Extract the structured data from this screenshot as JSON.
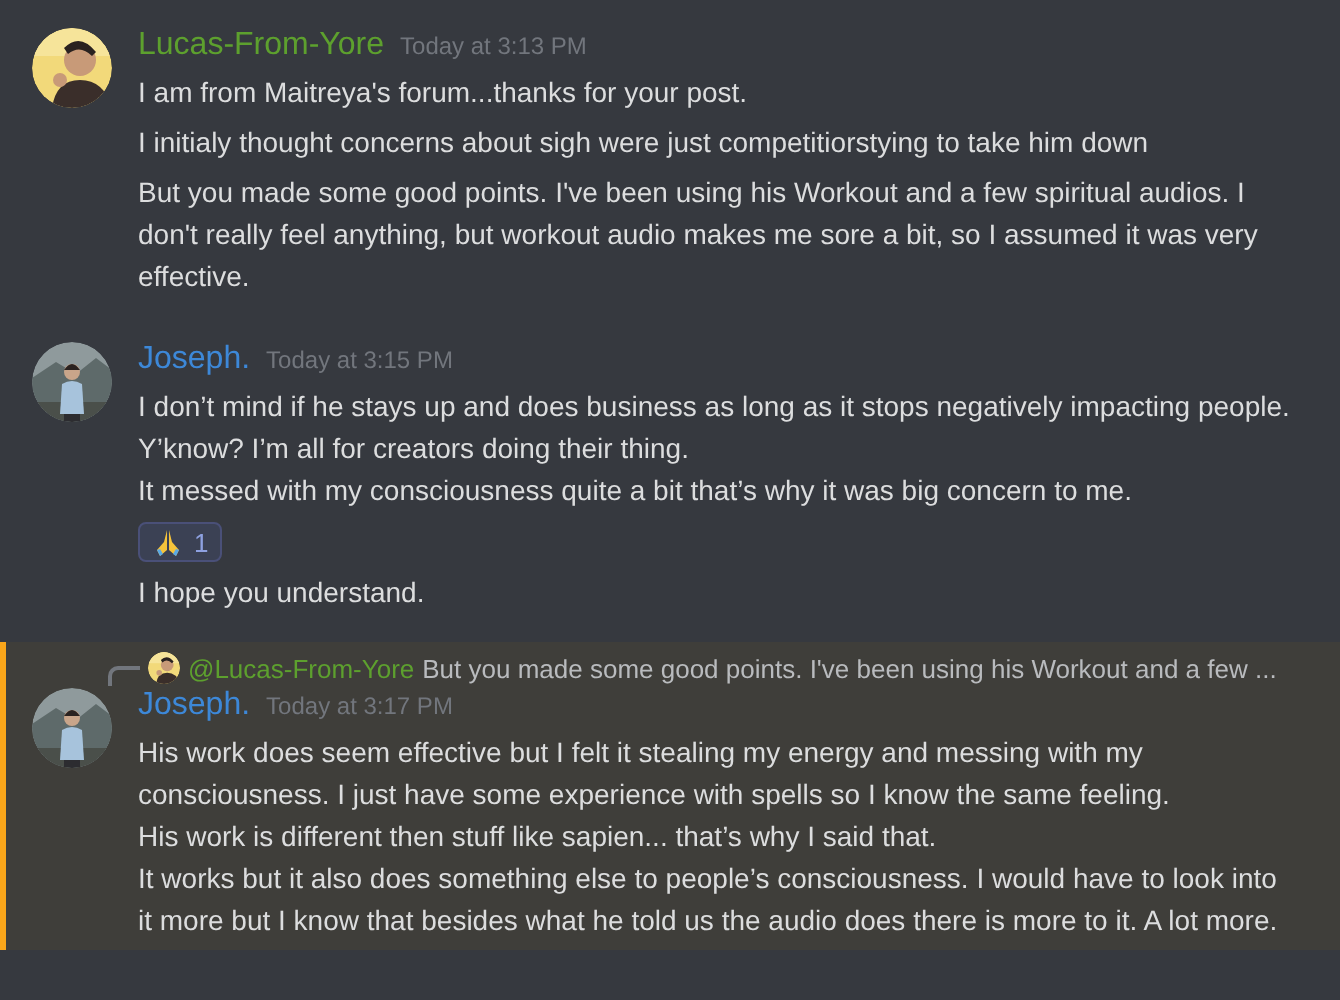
{
  "messages": [
    {
      "author": "Lucas-From-Yore",
      "color": "#5da02e",
      "time": "Today at 3:13 PM",
      "highlighted": false,
      "avatar": {
        "kind": "picture"
      },
      "items": [
        {
          "text": "I am from Maitreya's forum...thanks for your post."
        },
        {
          "text": "I initialy thought concerns about sigh were just competitiorstying to take him down"
        },
        {
          "text": "But you made some good points. I've been using his Workout and a few spiritual audios. I don't really feel anything, but workout audio makes me sore  a bit, so I assumed it was very effective."
        }
      ]
    },
    {
      "author": "Joseph.",
      "color": "#3d88d8",
      "time": "Today at 3:15 PM",
      "highlighted": false,
      "avatar": {
        "kind": "picture"
      },
      "items": [
        {
          "text": "I don’t mind if he stays up and does business as long as it stops negatively impacting people. Y’know? I’m all for creators doing their thing.\nIt messed with my consciousness quite a bit that’s why it was big concern to me.",
          "reactions": [
            {
              "count": "1",
              "selected": true
            }
          ]
        },
        {
          "text": "I hope you understand."
        }
      ]
    },
    {
      "author": "Joseph.",
      "color": "#3d88d8",
      "time": "Today at 3:17 PM",
      "highlighted": true,
      "avatar": {
        "kind": "picture"
      },
      "reply": {
        "mention": "@Lucas-From-Yore",
        "snippet": "But you made some good points. I've been using his Workout and a few ..."
      },
      "items": [
        {
          "text": "His work does seem effective but I felt it stealing my energy and messing with my consciousness. I just have some experience with spells so I know the same feeling.\nHis work is different then stuff like sapien... that’s why I said that.\nIt works but it also does something else to people’s consciousness. I would have to look into it more but I know that besides what he told us the audio does there is more to it. A lot more."
        }
      ]
    }
  ]
}
